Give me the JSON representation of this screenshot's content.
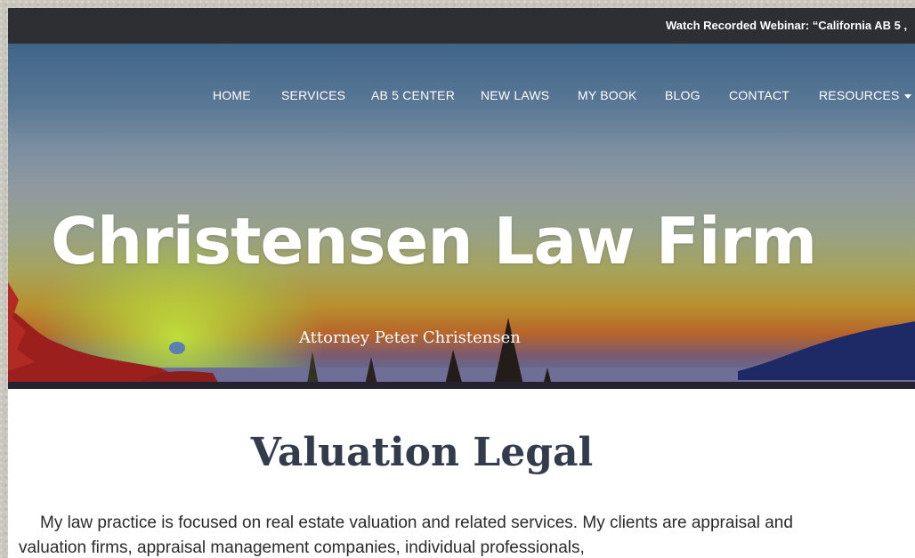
{
  "topbar": {
    "announcement": "Watch Recorded Webinar: “California AB 5 ,"
  },
  "nav": {
    "items": [
      {
        "label": "HOME"
      },
      {
        "label": "SERVICES"
      },
      {
        "label": "AB 5 CENTER"
      },
      {
        "label": "NEW LAWS"
      },
      {
        "label": "MY BOOK"
      },
      {
        "label": "BLOG"
      },
      {
        "label": "CONTACT"
      },
      {
        "label": "RESOURCES"
      }
    ]
  },
  "hero": {
    "title": "Christensen Law Firm",
    "subtitle": "Attorney Peter Christensen"
  },
  "content": {
    "heading": "Valuation Legal",
    "paragraph": "My law practice is focused on real estate valuation and related services. My clients are appraisal and valuation firms, appraisal management companies, individual professionals,"
  },
  "colors": {
    "topbar_bg": "#2e2f33",
    "heading": "#333c4c",
    "nav_text": "#ffffff"
  }
}
